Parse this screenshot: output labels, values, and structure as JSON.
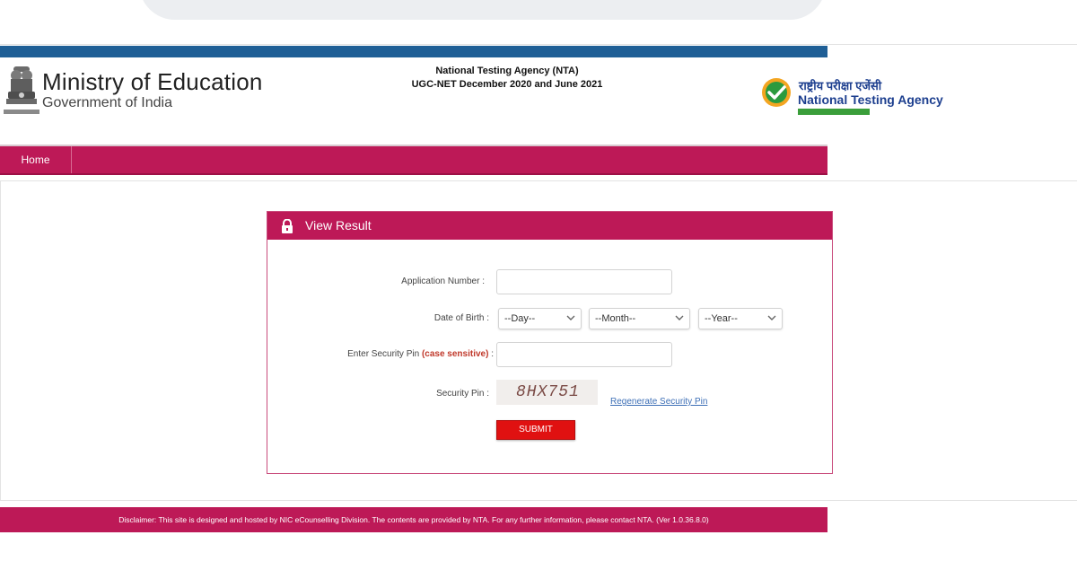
{
  "header": {
    "ministry_title": "Ministry of Education",
    "ministry_subtitle": "Government of India",
    "center_line1": "National Testing Agency (NTA)",
    "center_line2": "UGC-NET December 2020 and June 2021",
    "nta_hindi": "राष्ट्रीय परीक्षा एजेंसी",
    "nta_name": "National Testing Agency"
  },
  "nav": {
    "home_label": "Home"
  },
  "form": {
    "panel_title": "View Result",
    "application_label": "Application Number :",
    "application_value": "",
    "dob_label": "Date of Birth :",
    "day_selected": "--Day--",
    "month_selected": "--Month--",
    "year_selected": "--Year--",
    "security_label_prefix": "Enter Security Pin ",
    "security_label_emph": "(case sensitive)",
    "security_label_suffix": " :",
    "security_value": "",
    "captcha_label": "Security Pin :",
    "captcha_text": "8HX751",
    "regenerate_label": "Regenerate Security Pin",
    "submit_label": "SUBMIT"
  },
  "footer": {
    "disclaimer": "Disclaimer: This site is designed and hosted by NIC eCounselling Division. The contents are provided by NTA. For any further information, please contact NTA. (Ver 1.0.36.8.0)"
  },
  "colors": {
    "accent": "#bd1957",
    "top_bar": "#1f5f96",
    "submit": "#e01111",
    "nta_blue": "#1d3f8f",
    "link": "#3d6fb6"
  }
}
